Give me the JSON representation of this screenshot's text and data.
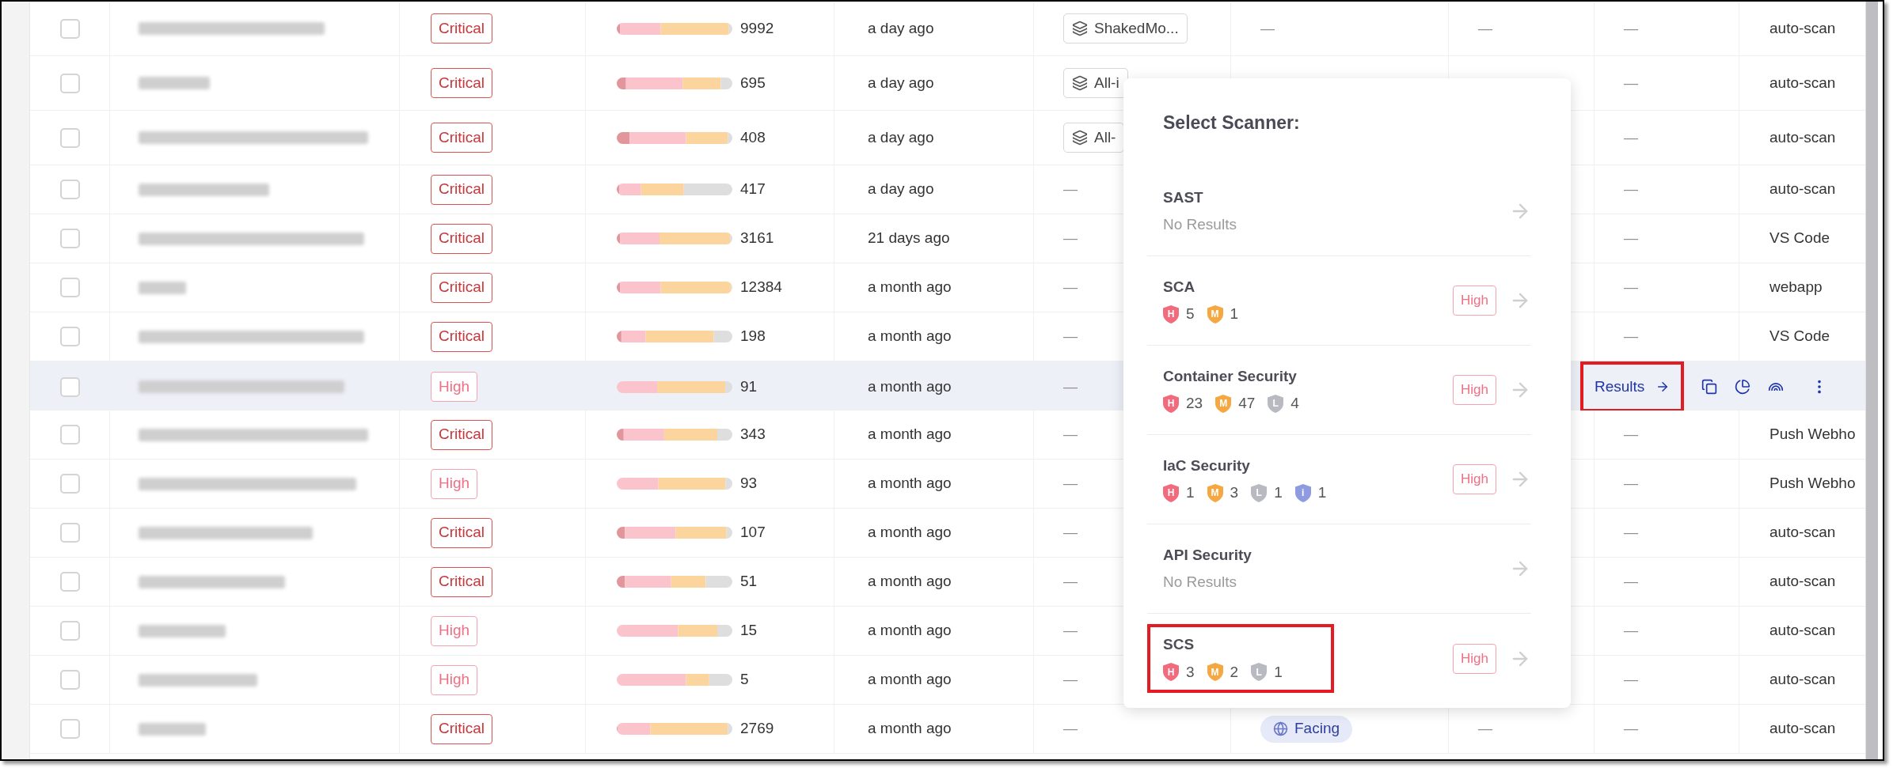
{
  "rows": [
    {
      "selected": false,
      "severity": {
        "kind": "critical",
        "label": "Critical"
      },
      "count": "9992",
      "date": "a day ago",
      "column_6": {
        "kind": "chip",
        "label": "ShakedMo..."
      },
      "column_7": {
        "kind": "dash",
        "text": "—"
      },
      "column_8": {
        "kind": "dash",
        "text": "—"
      },
      "column_9": {
        "kind": "dash",
        "text": "—"
      },
      "source": "auto-scan"
    },
    {
      "selected": false,
      "severity": {
        "kind": "critical",
        "label": "Critical"
      },
      "count": "695",
      "date": "a day ago",
      "column_6": {
        "kind": "chip",
        "label": "All-i"
      },
      "column_9": {
        "kind": "dash",
        "text": "—"
      },
      "source": "auto-scan"
    },
    {
      "selected": false,
      "severity": {
        "kind": "critical",
        "label": "Critical"
      },
      "count": "408",
      "date": "a day ago",
      "column_6": {
        "kind": "chip",
        "label": "All-"
      },
      "column_9": {
        "kind": "dash",
        "text": "—"
      },
      "source": "auto-scan"
    },
    {
      "selected": false,
      "severity": {
        "kind": "critical",
        "label": "Critical"
      },
      "count": "417",
      "date": "a day ago",
      "column_6": {
        "kind": "dash",
        "text": "—"
      },
      "column_9": {
        "kind": "dash",
        "text": "—"
      },
      "source": "auto-scan"
    },
    {
      "selected": false,
      "severity": {
        "kind": "critical",
        "label": "Critical"
      },
      "count": "3161",
      "date": "21 days ago",
      "column_6": {
        "kind": "dash",
        "text": "—"
      },
      "column_9": {
        "kind": "dash",
        "text": "—"
      },
      "source": "VS Code"
    },
    {
      "selected": false,
      "severity": {
        "kind": "critical",
        "label": "Critical"
      },
      "count": "12384",
      "date": "a month ago",
      "column_6": {
        "kind": "dash",
        "text": "—"
      },
      "column_9": {
        "kind": "dash",
        "text": "—"
      },
      "source": "webapp"
    },
    {
      "selected": false,
      "severity": {
        "kind": "critical",
        "label": "Critical"
      },
      "count": "198",
      "date": "a month ago",
      "column_6": {
        "kind": "dash",
        "text": "—"
      },
      "column_9": {
        "kind": "dash",
        "text": "—"
      },
      "source": "VS Code"
    },
    {
      "selected": true,
      "severity": {
        "kind": "high",
        "label": "High"
      },
      "count": "91",
      "date": "a month ago",
      "column_6": {
        "kind": "dash",
        "text": "—"
      },
      "actions": {
        "label": "Results",
        "highlighted": true
      }
    },
    {
      "selected": false,
      "severity": {
        "kind": "critical",
        "label": "Critical"
      },
      "count": "343",
      "date": "a month ago",
      "column_6": {
        "kind": "dash",
        "text": "—"
      },
      "column_9": {
        "kind": "dash",
        "text": "—"
      },
      "source": "Push Webho"
    },
    {
      "selected": false,
      "severity": {
        "kind": "high",
        "label": "High"
      },
      "count": "93",
      "date": "a month ago",
      "column_6": {
        "kind": "dash",
        "text": "—"
      },
      "column_9": {
        "kind": "dash",
        "text": "—"
      },
      "source": "Push Webho"
    },
    {
      "selected": false,
      "severity": {
        "kind": "critical",
        "label": "Critical"
      },
      "count": "107",
      "date": "a month ago",
      "column_6": {
        "kind": "dash",
        "text": "—"
      },
      "column_9": {
        "kind": "dash",
        "text": "—"
      },
      "source": "auto-scan"
    },
    {
      "selected": false,
      "severity": {
        "kind": "critical",
        "label": "Critical"
      },
      "count": "51",
      "date": "a month ago",
      "column_6": {
        "kind": "dash",
        "text": "—"
      },
      "column_9": {
        "kind": "dash",
        "text": "—"
      },
      "source": "auto-scan"
    },
    {
      "selected": false,
      "severity": {
        "kind": "high",
        "label": "High"
      },
      "count": "15",
      "date": "a month ago",
      "column_6": {
        "kind": "dash",
        "text": "—"
      },
      "column_9": {
        "kind": "dash",
        "text": "—"
      },
      "source": "auto-scan"
    },
    {
      "selected": false,
      "severity": {
        "kind": "high",
        "label": "High"
      },
      "count": "5",
      "date": "a month ago",
      "column_6": {
        "kind": "dash",
        "text": "—"
      },
      "column_9": {
        "kind": "dash",
        "text": "—"
      },
      "source": "auto-scan"
    },
    {
      "selected": false,
      "severity": {
        "kind": "critical",
        "label": "Critical"
      },
      "count": "2769",
      "date": "a month ago",
      "column_6": {
        "kind": "dash",
        "text": "—"
      },
      "column_7": {
        "kind": "facing",
        "label": "Facing"
      },
      "column_8": {
        "kind": "dash",
        "text": "—"
      },
      "column_9": {
        "kind": "dash",
        "text": "—"
      },
      "source": "auto-scan"
    }
  ],
  "scanner_menu": {
    "title": "Select Scanner:",
    "scanners": [
      {
        "name": "SAST",
        "note": "No Results",
        "highlighted": false
      },
      {
        "name": "SCA",
        "counts": [
          {
            "kind": "high",
            "letter": "H",
            "value": "5"
          },
          {
            "kind": "medium",
            "letter": "M",
            "value": "1"
          }
        ],
        "badge": "High",
        "highlighted": false
      },
      {
        "name": "Container Security",
        "counts": [
          {
            "kind": "high",
            "letter": "H",
            "value": "23"
          },
          {
            "kind": "medium",
            "letter": "M",
            "value": "47"
          },
          {
            "kind": "low",
            "letter": "L",
            "value": "4"
          }
        ],
        "badge": "High",
        "highlighted": false
      },
      {
        "name": "IaC Security",
        "counts": [
          {
            "kind": "high",
            "letter": "H",
            "value": "1"
          },
          {
            "kind": "medium",
            "letter": "M",
            "value": "3"
          },
          {
            "kind": "low",
            "letter": "L",
            "value": "1"
          },
          {
            "kind": "info",
            "letter": "i",
            "value": "1"
          }
        ],
        "badge": "High",
        "highlighted": false
      },
      {
        "name": "API Security",
        "note": "No Results",
        "highlighted": false
      },
      {
        "name": "SCS",
        "counts": [
          {
            "kind": "high",
            "letter": "H",
            "value": "3"
          },
          {
            "kind": "medium",
            "letter": "M",
            "value": "2"
          },
          {
            "kind": "low",
            "letter": "L",
            "value": "1"
          }
        ],
        "badge": "High",
        "highlighted": true
      }
    ]
  }
}
